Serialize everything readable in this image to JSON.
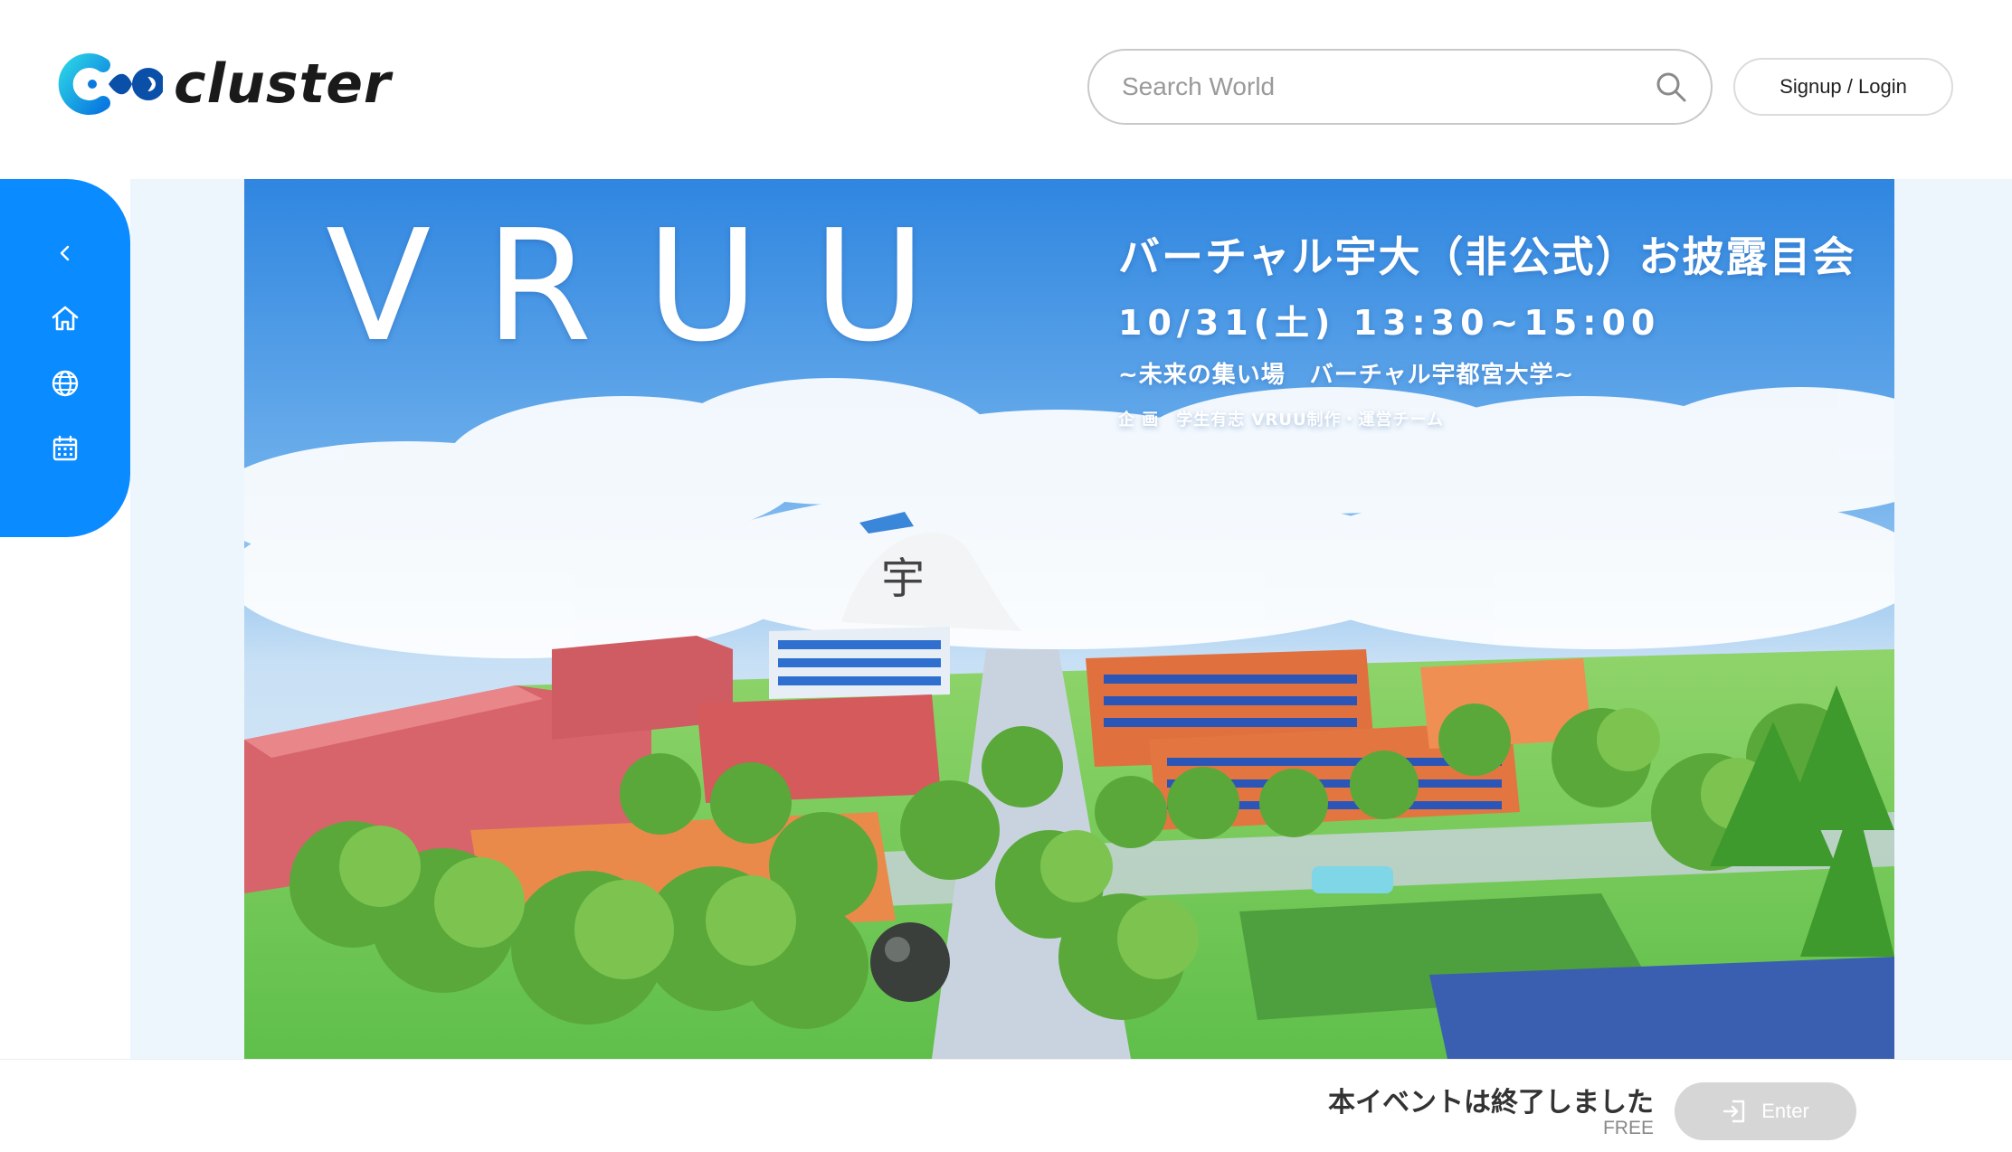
{
  "brand": {
    "name": "cluster",
    "logo_icon": "cluster-logo-icon"
  },
  "search": {
    "placeholder": "Search World",
    "value": "",
    "icon": "search-icon"
  },
  "auth": {
    "login_label": "Signup / Login"
  },
  "sidebar": {
    "items": [
      {
        "icon": "chevron-left-icon",
        "name": "collapse"
      },
      {
        "icon": "home-icon",
        "name": "home"
      },
      {
        "icon": "globe-icon",
        "name": "worlds"
      },
      {
        "icon": "calendar-icon",
        "name": "events"
      }
    ],
    "color": "#0a8bff"
  },
  "hero": {
    "logo_text": "VRUU",
    "title": "バーチャル宇大（非公式）お披露目会",
    "date": "10/31(土)  13:30~15:00",
    "subtitle": "~未来の集い場　バーチャル宇都宮大学~",
    "organizer": "企 画　学生有志 VRUU制作・運営チーム",
    "mountain_glyph": "宇"
  },
  "footer": {
    "status": "本イベントは終了しました",
    "price": "FREE",
    "enter_label": "Enter",
    "enter_icon": "enter-icon"
  },
  "colors": {
    "accent": "#0a8bff",
    "logo_cyan": "#21c7e0",
    "logo_blue": "#0a6cd6",
    "disabled": "#d6d6d6"
  }
}
